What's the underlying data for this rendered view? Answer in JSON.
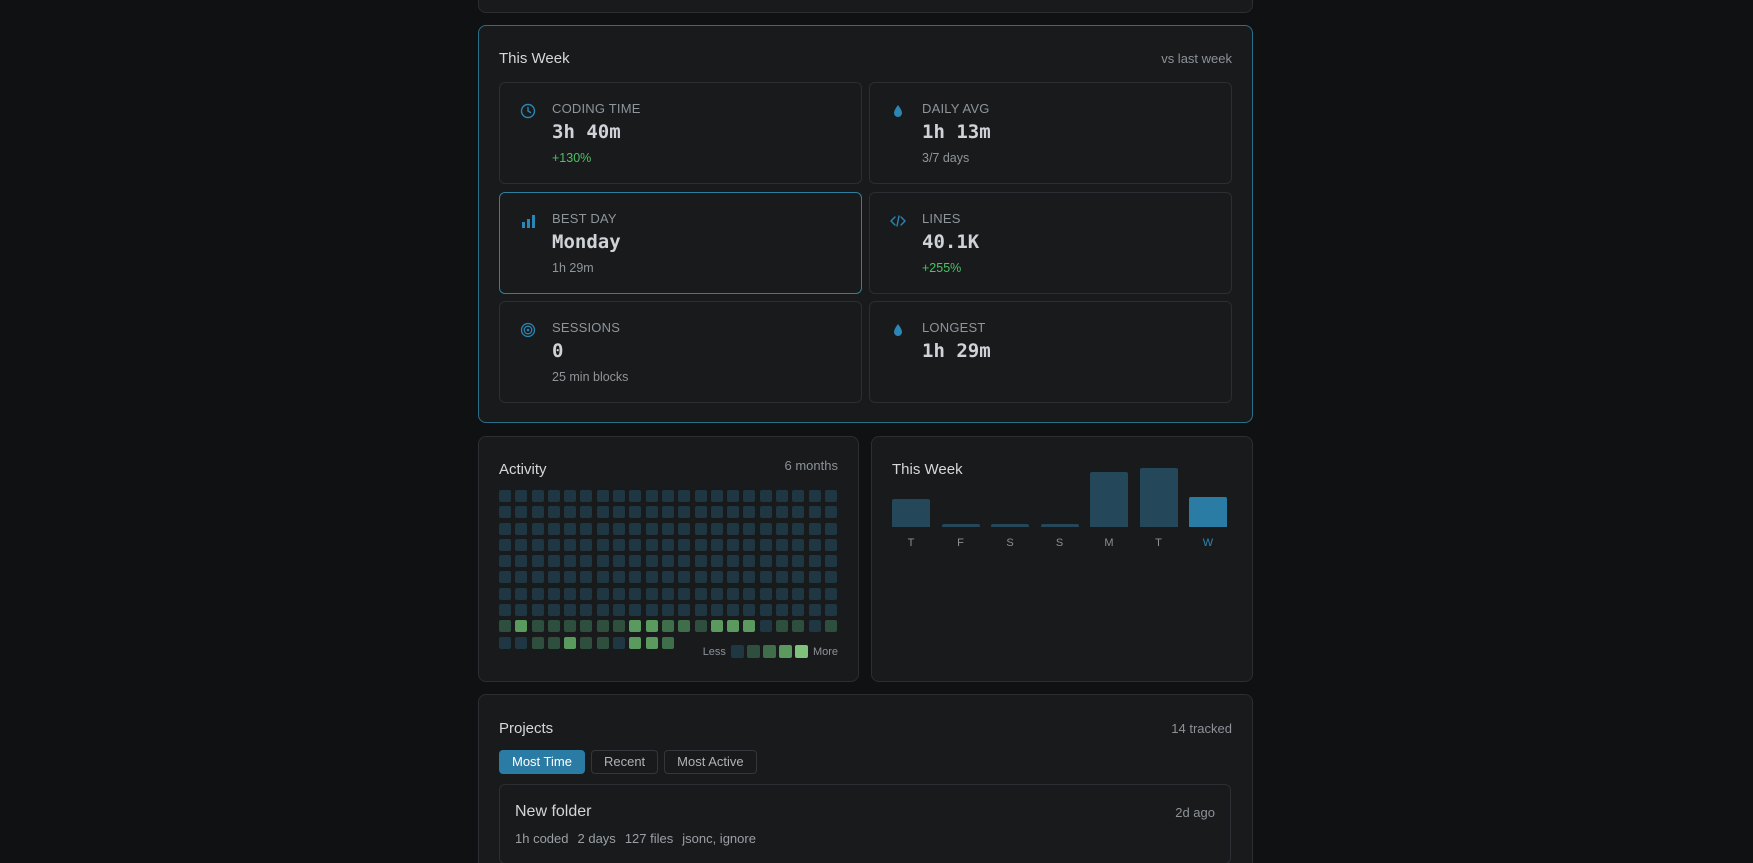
{
  "week_card": {
    "title": "This Week",
    "meta": "vs last week",
    "stats": [
      {
        "label": "CODING TIME",
        "value": "3h 40m",
        "sub": "+130%",
        "icon": "clock-icon"
      },
      {
        "label": "DAILY AVG",
        "value": "1h 13m",
        "sub": "3/7 days",
        "icon": "droplet-icon"
      },
      {
        "label": "BEST DAY",
        "value": "Monday",
        "sub": "1h 29m",
        "icon": "bar-chart-icon"
      },
      {
        "label": "LINES",
        "value": "40.1K",
        "sub": "+255%",
        "icon": "code-icon"
      },
      {
        "label": "SESSIONS",
        "value": "0",
        "sub": "25 min blocks",
        "icon": "target-icon"
      },
      {
        "label": "LONGEST",
        "value": "1h 29m",
        "sub": "",
        "icon": "droplet-icon"
      }
    ]
  },
  "activity": {
    "title": "Activity",
    "range": "6 months",
    "legend_less": "Less",
    "legend_more": "More",
    "legend_colors": [
      "#1f3742",
      "#2f4f3e",
      "#3f6e4a",
      "#5a9a5e",
      "#7ec27c"
    ],
    "levels": [
      0,
      0,
      0,
      0,
      0,
      0,
      0,
      0,
      0,
      0,
      0,
      0,
      0,
      0,
      0,
      0,
      0,
      0,
      0,
      0,
      0,
      0,
      0,
      0,
      0,
      0,
      0,
      0,
      0,
      0,
      0,
      0,
      0,
      0,
      0,
      0,
      0,
      0,
      0,
      0,
      0,
      0,
      0,
      0,
      0,
      0,
      0,
      0,
      0,
      0,
      0,
      0,
      0,
      0,
      0,
      0,
      0,
      0,
      0,
      0,
      0,
      0,
      0,
      0,
      0,
      0,
      0,
      0,
      0,
      0,
      0,
      0,
      0,
      0,
      0,
      0,
      0,
      0,
      0,
      0,
      0,
      0,
      0,
      0,
      0,
      0,
      0,
      0,
      0,
      0,
      0,
      0,
      0,
      0,
      0,
      0,
      0,
      0,
      0,
      0,
      0,
      0,
      0,
      0,
      0,
      0,
      0,
      0,
      0,
      0,
      0,
      0,
      0,
      0,
      0,
      0,
      0,
      0,
      0,
      0,
      0,
      0,
      0,
      0,
      0,
      0,
      0,
      0,
      0,
      0,
      0,
      0,
      0,
      0,
      0,
      0,
      0,
      0,
      0,
      0,
      0,
      0,
      0,
      0,
      0,
      0,
      0,
      0,
      0,
      0,
      0,
      0,
      0,
      0,
      0,
      0,
      0,
      0,
      0,
      0,
      0,
      0,
      0,
      0,
      0,
      0,
      0,
      0,
      1,
      3,
      1,
      1,
      1,
      1,
      1,
      1,
      3,
      3,
      2,
      2,
      1,
      3,
      3,
      3,
      0,
      1,
      1,
      0,
      1,
      0,
      0,
      1,
      1,
      3,
      1,
      1,
      0,
      3,
      3,
      2,
      -1,
      -1,
      -1,
      -1,
      -1,
      -1,
      -1
    ]
  },
  "week_chart": {
    "title": "This Week",
    "chart_data": {
      "type": "bar",
      "categories": [
        "T",
        "F",
        "S",
        "S",
        "M",
        "T",
        "W"
      ],
      "values": [
        0.46,
        0.05,
        0.05,
        0.05,
        0.92,
        0.98,
        0.5
      ],
      "current_index": 6,
      "ylim": [
        0,
        1
      ]
    }
  },
  "projects": {
    "title": "Projects",
    "count": "14 tracked",
    "tabs": [
      "Most Time",
      "Recent",
      "Most Active"
    ],
    "active_tab": 0,
    "items": [
      {
        "name": "New folder",
        "when": "2d ago",
        "meta": [
          "1h coded",
          "2 days",
          "127 files",
          "jsonc, ignore"
        ]
      }
    ]
  }
}
